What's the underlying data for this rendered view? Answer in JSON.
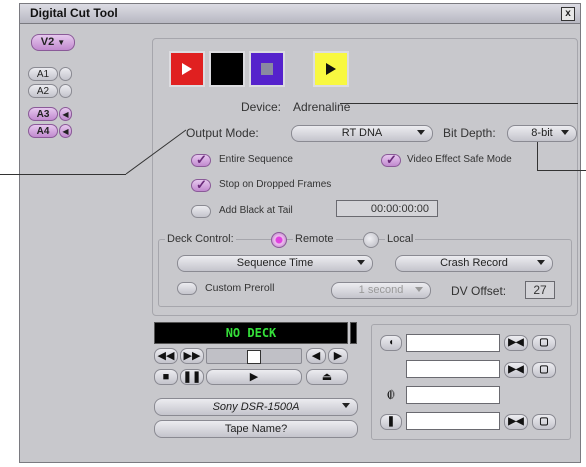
{
  "window": {
    "title": "Digital Cut Tool",
    "close_label": "x"
  },
  "tracks": {
    "video_button": "V2",
    "audio": [
      {
        "label": "A1",
        "active": false
      },
      {
        "label": "A2",
        "active": false
      },
      {
        "label": "A3",
        "active": true
      },
      {
        "label": "A4",
        "active": true
      }
    ]
  },
  "output": {
    "color_squares": [
      "#e02020",
      "#000000",
      "#5522cc",
      "#f8f840"
    ],
    "device_label": "Device:",
    "device_value": "Adrenaline",
    "output_mode_label": "Output Mode:",
    "output_mode_value": "RT DNA",
    "bit_depth_label": "Bit Depth:",
    "bit_depth_value": "8-bit"
  },
  "options": {
    "entire_sequence": "Entire Sequence",
    "video_effect_safe": "Video Effect Safe Mode",
    "stop_on_dropped": "Stop on Dropped Frames",
    "add_black": "Add Black at Tail",
    "add_black_time": "00:00:00:00"
  },
  "deck": {
    "control_label": "Deck Control:",
    "remote_label": "Remote",
    "local_label": "Local",
    "time_mode": "Sequence Time",
    "record_mode": "Crash Record",
    "custom_preroll": "Custom Preroll",
    "preroll_value": "1 second",
    "dv_offset_label": "DV Offset:",
    "dv_offset_value": "27"
  },
  "transport": {
    "display": "NO DECK",
    "deck_model": "Sony DSR-1500A",
    "tape_name": "Tape Name?"
  }
}
